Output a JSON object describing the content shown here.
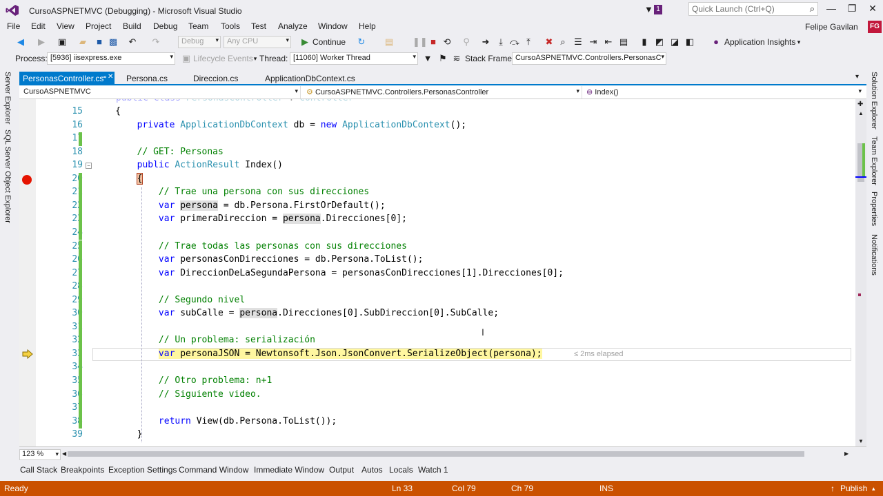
{
  "window": {
    "title": "CursoASPNETMVC (Debugging) - Microsoft Visual Studio",
    "notification_count": "1",
    "quick_launch_placeholder": "Quick Launch (Ctrl+Q)"
  },
  "menu": {
    "items": [
      "File",
      "Edit",
      "View",
      "Project",
      "Build",
      "Debug",
      "Team",
      "Tools",
      "Test",
      "Analyze",
      "Window",
      "Help"
    ],
    "user_name": "Felipe Gavilan",
    "user_initials": "FG"
  },
  "toolbar": {
    "config": "Debug",
    "platform": "Any CPU",
    "continue_label": "Continue",
    "app_insights_label": "Application Insights"
  },
  "debug_location": {
    "process_label": "Process:",
    "process_value": "[5936] iisexpress.exe",
    "lifecycle_label": "Lifecycle Events",
    "thread_label": "Thread:",
    "thread_value": "[11060] Worker Thread",
    "stack_frame_label": "Stack Frame:",
    "stack_frame_value": "CursoASPNETMVC.Controllers.PersonasC"
  },
  "side_tabs": {
    "left": [
      "Server Explorer",
      "SQL Server Object Explorer"
    ],
    "right": [
      "Solution Explorer",
      "Team Explorer",
      "Properties",
      "Notifications"
    ]
  },
  "doc_tabs": [
    {
      "label": "PersonasController.cs",
      "active": true
    },
    {
      "label": "Persona.cs",
      "active": false
    },
    {
      "label": "Direccion.cs",
      "active": false
    },
    {
      "label": "ApplicationDbContext.cs",
      "active": false
    }
  ],
  "nav": {
    "project": "CursoASPNETMVC",
    "class": "CursoASPNETMVC.Controllers.PersonasController",
    "member": "Index()"
  },
  "code_lines": [
    {
      "n": "15",
      "text": "    {"
    },
    {
      "n": "16",
      "text": "        private ApplicationDbContext db = new ApplicationDbContext();"
    },
    {
      "n": "17",
      "text": ""
    },
    {
      "n": "18",
      "text": "        // GET: Personas"
    },
    {
      "n": "19",
      "text": "        public ActionResult Index()"
    },
    {
      "n": "20",
      "text": "        {"
    },
    {
      "n": "21",
      "text": "            // Trae una persona con sus direcciones"
    },
    {
      "n": "22",
      "text": "            var persona = db.Persona.FirstOrDefault();"
    },
    {
      "n": "23",
      "text": "            var primeraDireccion = persona.Direcciones[0];"
    },
    {
      "n": "24",
      "text": ""
    },
    {
      "n": "25",
      "text": "            // Trae todas las personas con sus direcciones"
    },
    {
      "n": "26",
      "text": "            var personasConDirecciones = db.Persona.ToList();"
    },
    {
      "n": "27",
      "text": "            var DireccionDeLaSegundaPersona = personasConDirecciones[1].Direcciones[0];"
    },
    {
      "n": "28",
      "text": ""
    },
    {
      "n": "29",
      "text": "            // Segundo nivel"
    },
    {
      "n": "30",
      "text": "            var subCalle = persona.Direcciones[0].SubDireccion[0].SubCalle;"
    },
    {
      "n": "31",
      "text": ""
    },
    {
      "n": "32",
      "text": "            // Un problema: serialización"
    },
    {
      "n": "33",
      "text": "            var personaJSON = Newtonsoft.Json.JsonConvert.SerializeObject(persona);"
    },
    {
      "n": "34",
      "text": ""
    },
    {
      "n": "35",
      "text": "            // Otro problema: n+1"
    },
    {
      "n": "36",
      "text": "            // Siguiente video."
    },
    {
      "n": "37",
      "text": ""
    },
    {
      "n": "38",
      "text": "            return View(db.Persona.ToList());"
    },
    {
      "n": "39",
      "text": "        }"
    }
  ],
  "elapsed_hint": "≤ 2ms elapsed",
  "zoom": "123 %",
  "bottom_tabs": [
    "Call Stack",
    "Breakpoints",
    "Exception Settings",
    "Command Window",
    "Immediate Window",
    "Output",
    "Autos",
    "Locals",
    "Watch 1"
  ],
  "status": {
    "state": "Ready",
    "ln": "Ln 33",
    "col": "Col 79",
    "ch": "Ch 79",
    "mode": "INS",
    "publish": "Publish"
  },
  "colors": {
    "accent": "#007acc",
    "status_bar": "#ca5100",
    "breakpoint": "#e51400",
    "current_line": "#fff7a0"
  }
}
